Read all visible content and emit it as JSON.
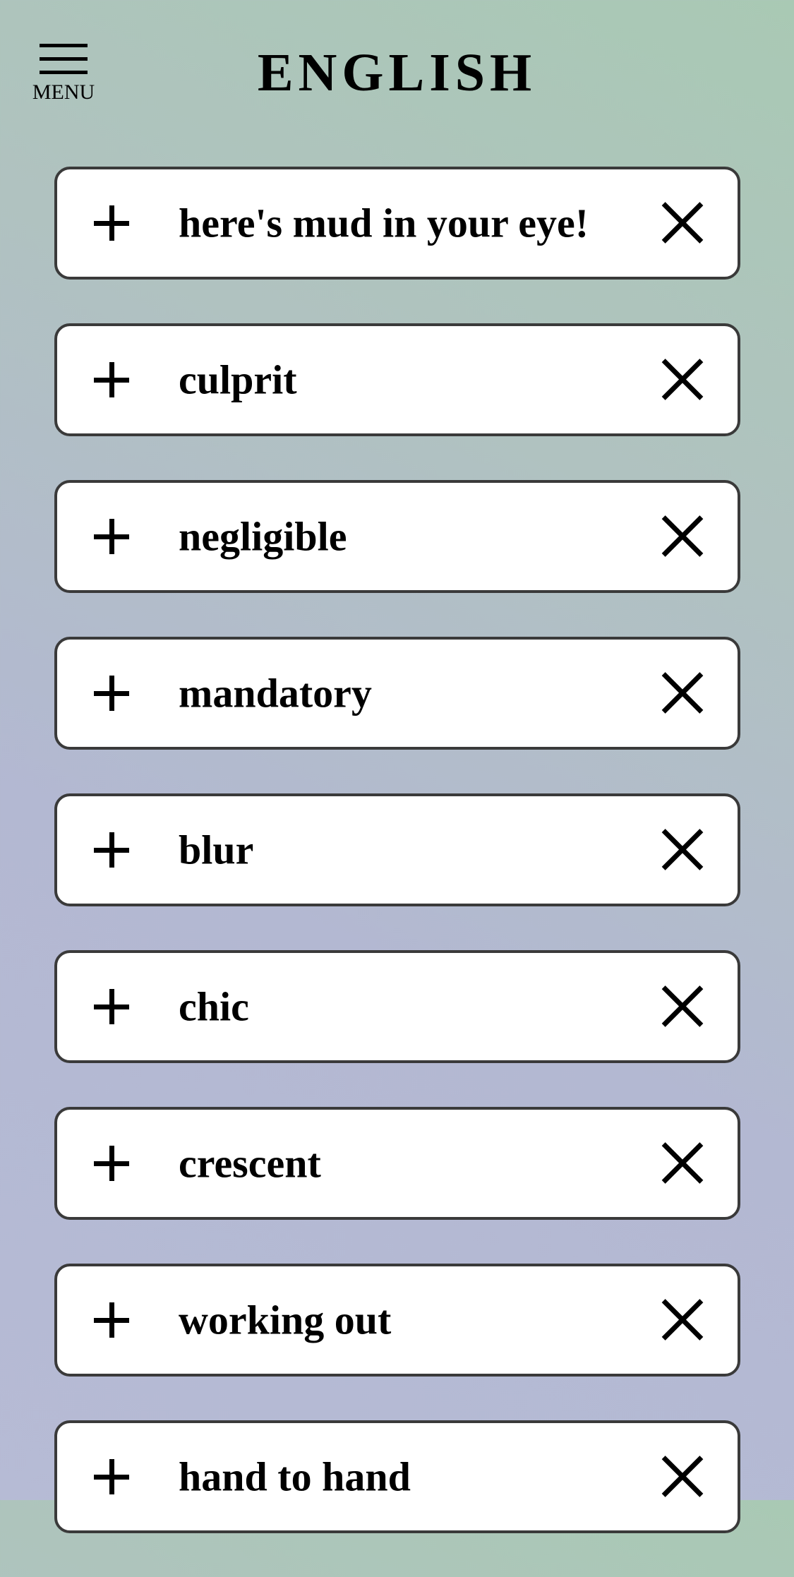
{
  "header": {
    "menu_label": "MENU",
    "title": "ENGLISH"
  },
  "words": [
    {
      "text": "here's mud in your eye!"
    },
    {
      "text": "culprit"
    },
    {
      "text": "negligible"
    },
    {
      "text": "mandatory"
    },
    {
      "text": "blur"
    },
    {
      "text": "chic"
    },
    {
      "text": "crescent"
    },
    {
      "text": "working out"
    },
    {
      "text": "hand to hand"
    }
  ],
  "icons": {
    "menu": "hamburger-menu-icon",
    "add": "plus-icon",
    "remove": "close-icon"
  }
}
